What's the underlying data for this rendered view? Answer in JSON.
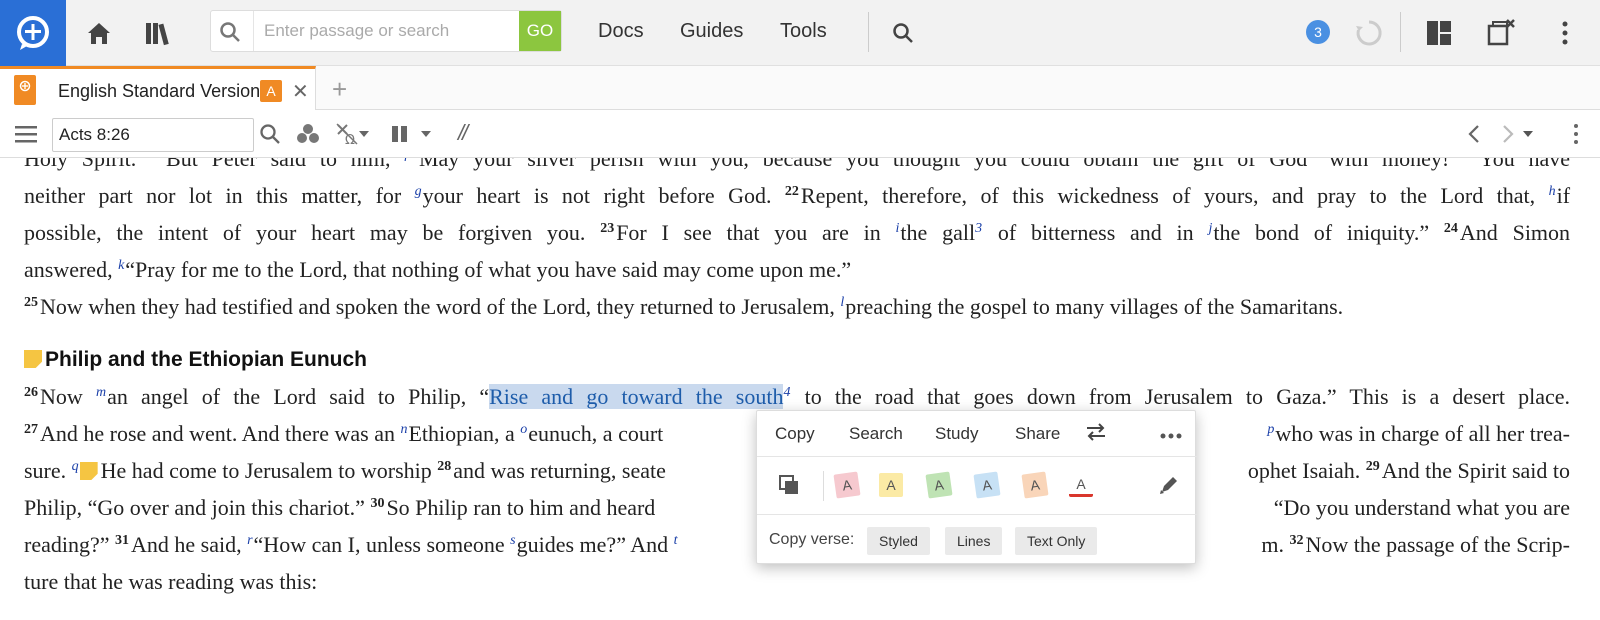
{
  "topbar": {
    "search_placeholder": "Enter passage or search",
    "go_label": "GO",
    "nav": [
      "Docs",
      "Guides",
      "Tools"
    ],
    "notification_count": "3"
  },
  "tab": {
    "title": "English Standard Version",
    "badge": "A",
    "add_label": "+"
  },
  "toolbar": {
    "reference": "Acts 8:26"
  },
  "text": {
    "l0": {
      "a": "Holy Spirit.",
      "v1": "20",
      "b": "But Peter said to him,",
      "x1": "f",
      "c": "“May your silver perish with you, because you thought you could obtain the gift of God",
      "x2": "3",
      "d": "with money!",
      "v2": "21",
      "e": "You have"
    },
    "l1": {
      "a": "neither part nor lot in this matter, for",
      "x1": "g",
      "b": "your heart is not right before God.",
      "v1": "22",
      "c": "Repent, therefore, of this wickedness of yours, and pray to the Lord that,",
      "x2": "h",
      "d": "if"
    },
    "l2": {
      "a": "possible, the intent of your heart may be forgiven you.",
      "v1": "23",
      "b": "For I see that you are in",
      "x1": "i",
      "c": "the gall",
      "x2": "3",
      "d": "of bitterness and in",
      "x3": "j",
      "e": "the bond of iniquity.”",
      "v2": "24",
      "f": "And Simon"
    },
    "l3": {
      "a": "answered,",
      "x1": "k",
      "b": "“Pray for me to the Lord, that nothing of what you have said may come upon me.”"
    },
    "l4": {
      "v1": "25",
      "a": "Now when they had testified and spoken the word of the Lord, they returned to Jerusalem,",
      "x1": "l",
      "b": "preaching the gospel to many villages of the Samaritans."
    },
    "heading": "Philip and the Ethiopian Eunuch",
    "l5": {
      "v1": "26",
      "a": "Now",
      "x1": "m",
      "b": "an angel of the Lord said to Philip, “",
      "hl": "Rise and go toward the south",
      "x2": "4",
      "c": "to the road that goes down from Jerusalem to Gaza.” This is a desert place."
    },
    "l6": {
      "v1": "27",
      "a": "And he rose and went. And there was an",
      "x1": "n",
      "b": "Ethiopian, a",
      "x2": "o",
      "c": "eunuch, a court",
      "x3": "p",
      "d": "who was in charge of all her trea-"
    },
    "l7": {
      "a": "sure.",
      "x1": "q",
      "b": "He had come to Jerusalem to worship",
      "v1": "28",
      "c": "and was returning, seate",
      "d": "ophet Isaiah.",
      "v2": "29",
      "e": "And the Spirit said to"
    },
    "l8": {
      "a": "Philip, “Go over and join this chariot.”",
      "v1": "30",
      "b": "So Philip ran to him and heard",
      "c": "“Do you understand what you are"
    },
    "l9": {
      "a": "reading?”",
      "v1": "31",
      "b": "And he said,",
      "x1": "r",
      "c": "“How can I, unless someone",
      "x2": "s",
      "d": "guides me?” And",
      "x3": "t",
      "e": "m.",
      "v2": "32",
      "f": "Now the passage of the Scrip-"
    },
    "l10": {
      "a": "ture that he was reading was this:"
    }
  },
  "popup": {
    "actions": [
      "Copy",
      "Search",
      "Study",
      "Share"
    ],
    "highlight_letter": "A",
    "copy_verse_label": "Copy verse:",
    "copy_options": [
      "Styled",
      "Lines",
      "Text Only"
    ]
  },
  "colors": {
    "logo_bg": "#2a6fd6",
    "go_bg": "#8cc63f",
    "tab_accent": "#f08a24",
    "selection": "#c9d9ee",
    "footnote": "#1a3fa8"
  }
}
